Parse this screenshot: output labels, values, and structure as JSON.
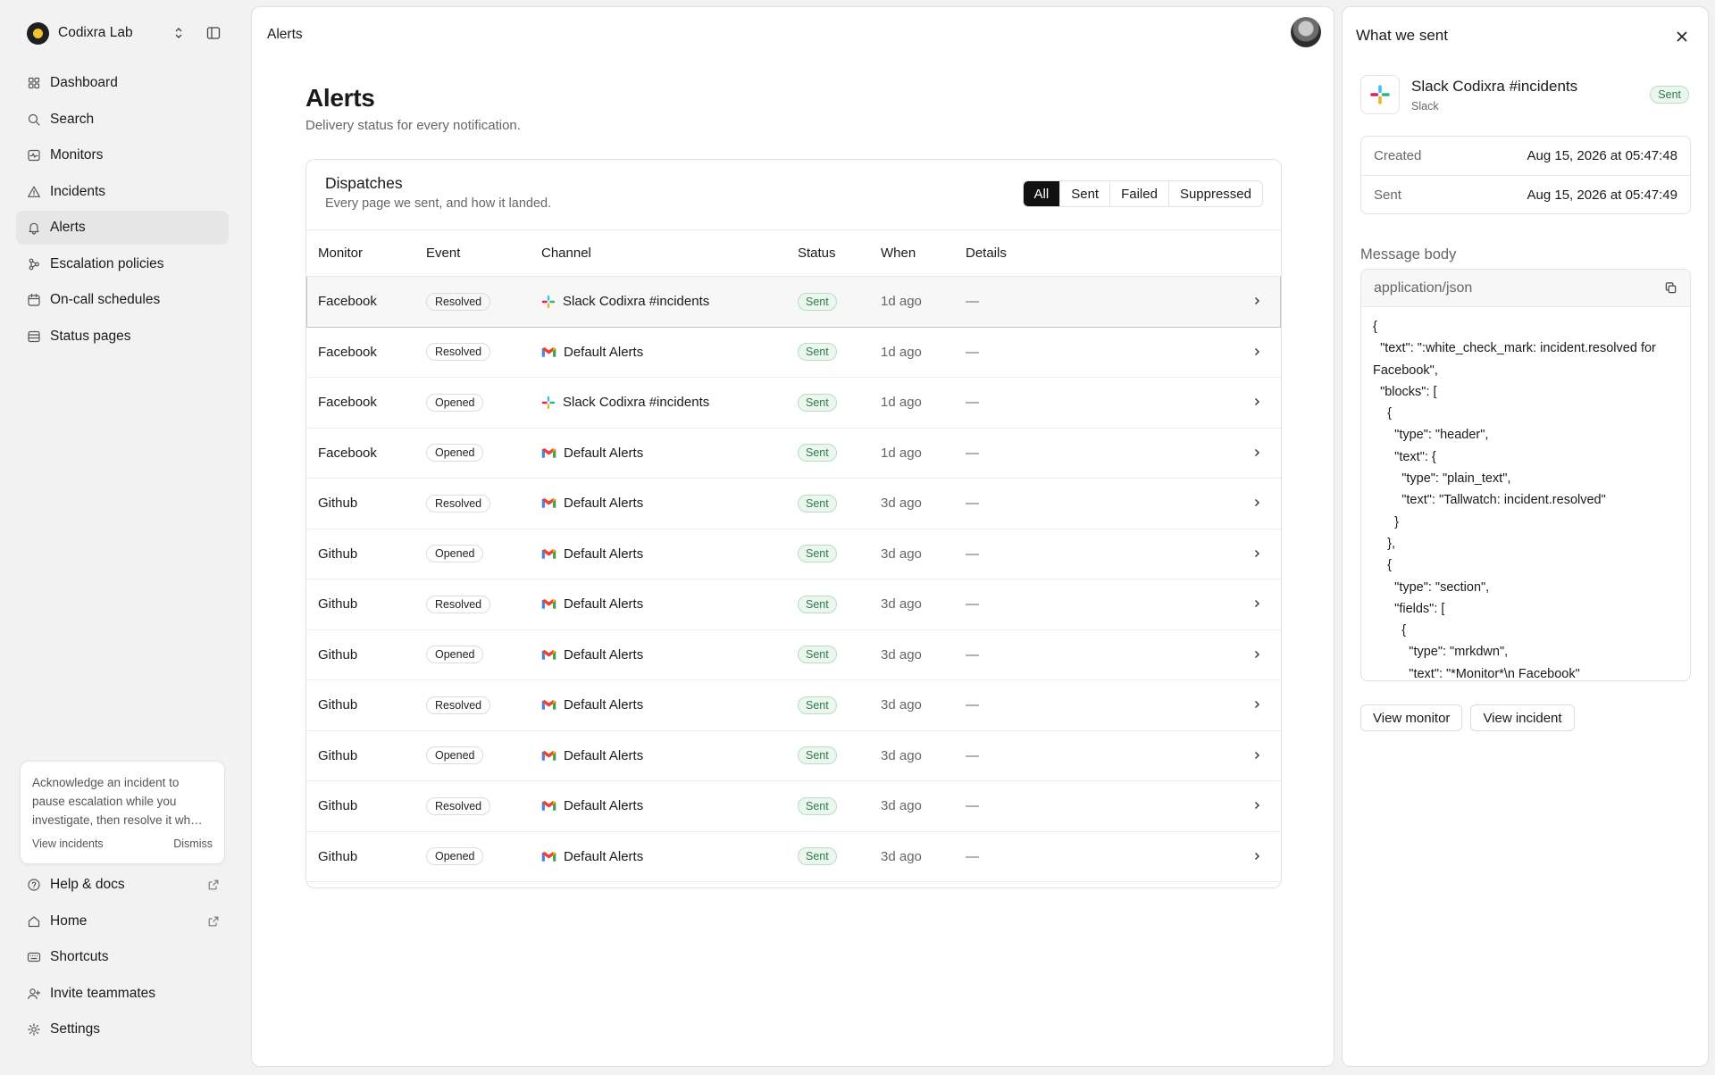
{
  "workspace": {
    "name": "Codixra Lab"
  },
  "nav": [
    {
      "label": "Dashboard",
      "icon": "dashboard-icon"
    },
    {
      "label": "Search",
      "icon": "search-icon"
    },
    {
      "label": "Monitors",
      "icon": "monitor-icon"
    },
    {
      "label": "Incidents",
      "icon": "warning-icon"
    },
    {
      "label": "Alerts",
      "icon": "bell-icon",
      "active": true
    },
    {
      "label": "Escalation policies",
      "icon": "escalation-icon"
    },
    {
      "label": "On-call schedules",
      "icon": "calendar-icon"
    },
    {
      "label": "Status pages",
      "icon": "status-page-icon"
    }
  ],
  "tip": {
    "text": "Acknowledge an incident to pause escalation while you investigate, then resolve it wh…",
    "view_label": "View incidents",
    "dismiss_label": "Dismiss"
  },
  "bottom_nav": [
    {
      "label": "Help & docs",
      "icon": "help-icon",
      "external": true
    },
    {
      "label": "Home",
      "icon": "home-icon",
      "external": true
    },
    {
      "label": "Shortcuts",
      "icon": "keyboard-icon"
    },
    {
      "label": "Invite teammates",
      "icon": "user-plus-icon"
    },
    {
      "label": "Settings",
      "icon": "gear-icon"
    }
  ],
  "main": {
    "breadcrumb": "Alerts",
    "title": "Alerts",
    "subtitle": "Delivery status for every notification.",
    "card": {
      "title": "Dispatches",
      "subtitle": "Every page we sent, and how it landed.",
      "filters": [
        "All",
        "Sent",
        "Failed",
        "Suppressed"
      ],
      "active_filter": "All",
      "columns": [
        "Monitor",
        "Event",
        "Channel",
        "Status",
        "When",
        "Details"
      ],
      "rows": [
        {
          "monitor": "Facebook",
          "event": "Resolved",
          "channel": "Slack Codixra #incidents",
          "channel_type": "slack",
          "status": "Sent",
          "when": "1d ago",
          "details": "—",
          "selected": true
        },
        {
          "monitor": "Facebook",
          "event": "Resolved",
          "channel": "Default Alerts",
          "channel_type": "gmail",
          "status": "Sent",
          "when": "1d ago",
          "details": "—"
        },
        {
          "monitor": "Facebook",
          "event": "Opened",
          "channel": "Slack Codixra #incidents",
          "channel_type": "slack",
          "status": "Sent",
          "when": "1d ago",
          "details": "—"
        },
        {
          "monitor": "Facebook",
          "event": "Opened",
          "channel": "Default Alerts",
          "channel_type": "gmail",
          "status": "Sent",
          "when": "1d ago",
          "details": "—"
        },
        {
          "monitor": "Github",
          "event": "Resolved",
          "channel": "Default Alerts",
          "channel_type": "gmail",
          "status": "Sent",
          "when": "3d ago",
          "details": "—"
        },
        {
          "monitor": "Github",
          "event": "Opened",
          "channel": "Default Alerts",
          "channel_type": "gmail",
          "status": "Sent",
          "when": "3d ago",
          "details": "—"
        },
        {
          "monitor": "Github",
          "event": "Resolved",
          "channel": "Default Alerts",
          "channel_type": "gmail",
          "status": "Sent",
          "when": "3d ago",
          "details": "—"
        },
        {
          "monitor": "Github",
          "event": "Opened",
          "channel": "Default Alerts",
          "channel_type": "gmail",
          "status": "Sent",
          "when": "3d ago",
          "details": "—"
        },
        {
          "monitor": "Github",
          "event": "Resolved",
          "channel": "Default Alerts",
          "channel_type": "gmail",
          "status": "Sent",
          "when": "3d ago",
          "details": "—"
        },
        {
          "monitor": "Github",
          "event": "Opened",
          "channel": "Default Alerts",
          "channel_type": "gmail",
          "status": "Sent",
          "when": "3d ago",
          "details": "—"
        },
        {
          "monitor": "Github",
          "event": "Resolved",
          "channel": "Default Alerts",
          "channel_type": "gmail",
          "status": "Sent",
          "when": "3d ago",
          "details": "—"
        },
        {
          "monitor": "Github",
          "event": "Opened",
          "channel": "Default Alerts",
          "channel_type": "gmail",
          "status": "Sent",
          "when": "3d ago",
          "details": "—"
        }
      ]
    }
  },
  "panel": {
    "title": "What we sent",
    "channel_name": "Slack Codixra #incidents",
    "channel_type": "Slack",
    "status": "Sent",
    "meta": [
      {
        "label": "Created",
        "value": "Aug 15, 2026 at 05:47:48"
      },
      {
        "label": "Sent",
        "value": "Aug 15, 2026 at 05:47:49"
      }
    ],
    "message_label": "Message body",
    "content_type": "application/json",
    "body": "{\n  \"text\": \":white_check_mark: incident.resolved for Facebook\",\n  \"blocks\": [\n    {\n      \"type\": \"header\",\n      \"text\": {\n        \"type\": \"plain_text\",\n        \"text\": \"Tallwatch: incident.resolved\"\n      }\n    },\n    {\n      \"type\": \"section\",\n      \"fields\": [\n        {\n          \"type\": \"mrkdwn\",\n          \"text\": \"*Monitor*\\n Facebook\"",
    "buttons": [
      "View monitor",
      "View incident"
    ]
  }
}
